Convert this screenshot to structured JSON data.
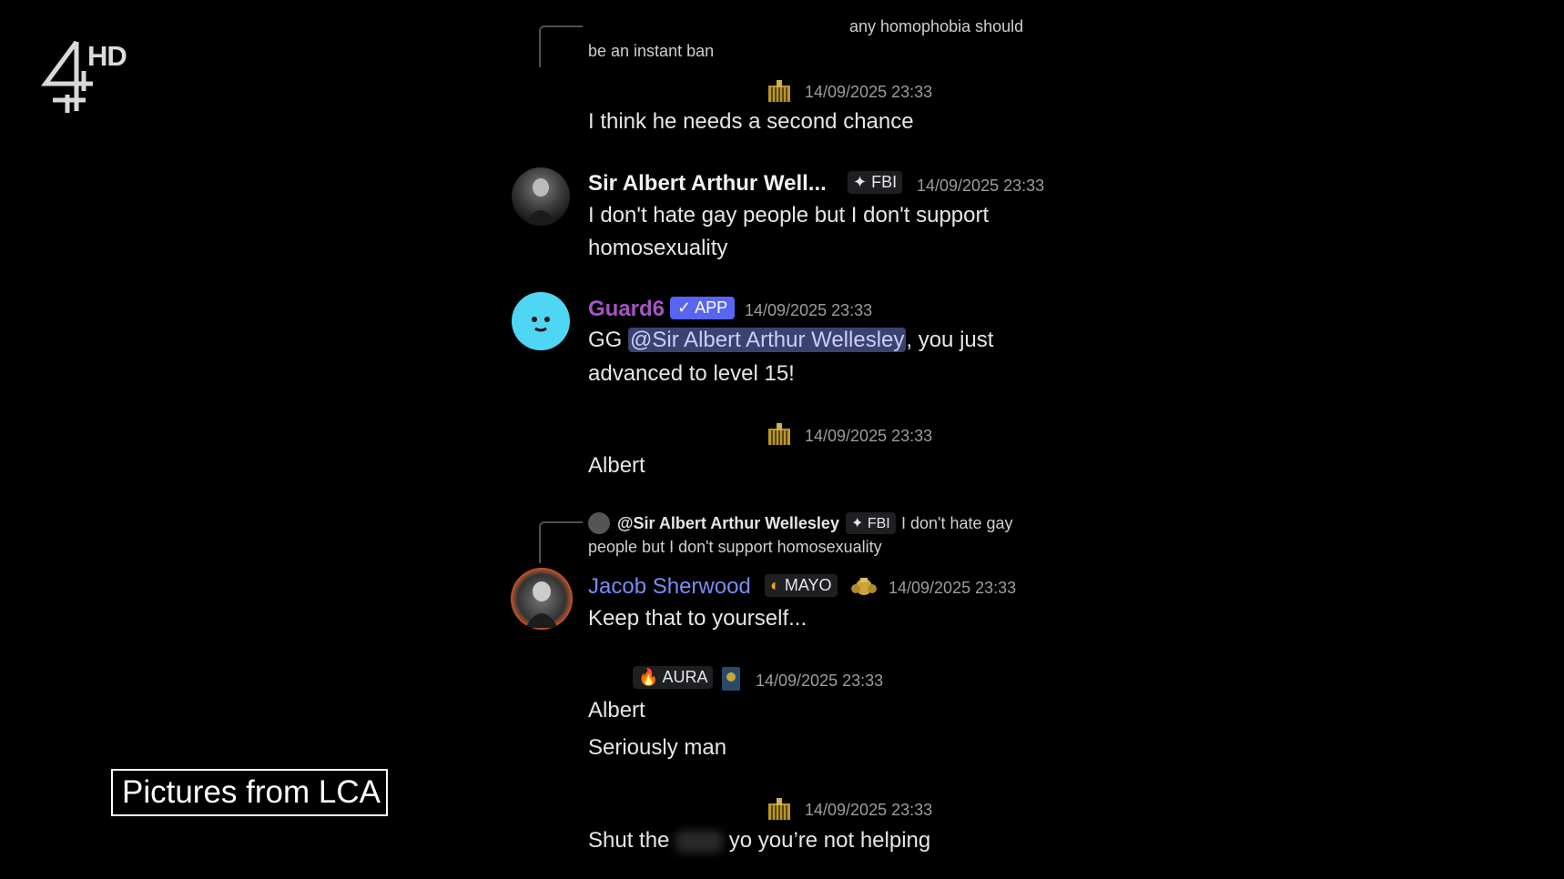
{
  "overlay": {
    "channel_hd": "HD",
    "caption": "Pictures from LCA"
  },
  "messages": {
    "m0": {
      "reply_a": "any homophobia should",
      "reply_b": "be an instant ban"
    },
    "m1": {
      "timestamp": "14/09/2025 23:33",
      "text": "I think he needs a second chance"
    },
    "m2": {
      "username": "Sir Albert Arthur Well...",
      "tag": "FBI",
      "timestamp": "14/09/2025 23:33",
      "line1": "I don't hate gay people but I don't support",
      "line2": "homosexuality"
    },
    "m3": {
      "username": "Guard6",
      "badge": "APP",
      "timestamp": "14/09/2025 23:33",
      "pre": "GG ",
      "mention": "@Sir Albert Arthur Wellesley",
      "post": ", you just",
      "line2": "advanced to level 15!"
    },
    "m4": {
      "timestamp": "14/09/2025 23:33",
      "text": "Albert"
    },
    "m5": {
      "reply_user": "@Sir Albert Arthur Wellesley",
      "reply_tag": "FBI",
      "reply_a": "I don't hate gay",
      "reply_b": "people but I don't support homosexuality",
      "username": "Jacob Sherwood",
      "tag": "MAYO",
      "timestamp": "14/09/2025 23:33",
      "text": "Keep that to yourself..."
    },
    "m6": {
      "tag": "AURA",
      "timestamp": "14/09/2025 23:33",
      "line1": "Albert",
      "line2": "Seriously man"
    },
    "m7": {
      "timestamp": "14/09/2025 23:33",
      "pre": "Shut the",
      "post": "yo you’re not helping"
    }
  },
  "colors": {
    "guard6_name": "#a355c0",
    "jacob_name": "#7b8bf5",
    "app_badge": "#5865f2",
    "mention_bg": "#3c4270"
  }
}
